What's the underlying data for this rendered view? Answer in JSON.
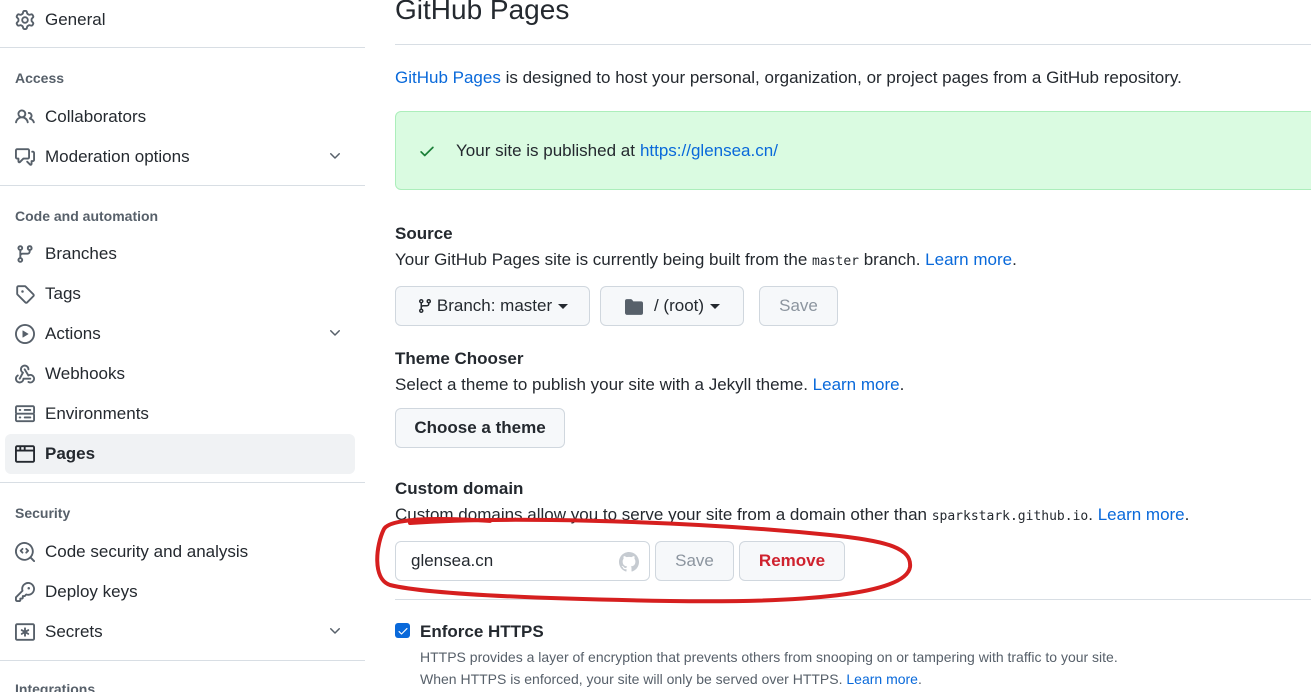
{
  "sidebar": {
    "general": "General",
    "access_head": "Access",
    "collaborators": "Collaborators",
    "moderation": "Moderation options",
    "code_head": "Code and automation",
    "branches": "Branches",
    "tags": "Tags",
    "actions": "Actions",
    "webhooks": "Webhooks",
    "environments": "Environments",
    "pages": "Pages",
    "security_head": "Security",
    "code_security": "Code security and analysis",
    "deploy_keys": "Deploy keys",
    "secrets": "Secrets",
    "integrations_head": "Integrations"
  },
  "main": {
    "title": "GitHub Pages",
    "intro_link": "GitHub Pages",
    "intro_rest": " is designed to host your personal, organization, or project pages from a GitHub repository.",
    "flash_text": "Your site is published at ",
    "flash_url": "https://glensea.cn/",
    "source": {
      "heading": "Source",
      "desc_a": "Your GitHub Pages site is currently being built from the ",
      "desc_code": "master",
      "desc_b": " branch. ",
      "learn_more": "Learn more",
      "branch_label": "Branch: master",
      "folder_label": "/ (root)",
      "save": "Save"
    },
    "theme": {
      "heading": "Theme Chooser",
      "desc": "Select a theme to publish your site with a Jekyll theme. ",
      "learn_more": "Learn more",
      "button": "Choose a theme"
    },
    "domain": {
      "heading": "Custom domain",
      "desc_a": "Custom domains allow you to serve your site from a domain other than ",
      "desc_code": "sparkstark.github.io",
      "desc_b": ". ",
      "learn_more": "Learn more",
      "value": "glensea.cn",
      "save": "Save",
      "remove": "Remove"
    },
    "https": {
      "label": "Enforce HTTPS",
      "checked": true,
      "line1": "HTTPS provides a layer of encryption that prevents others from snooping on or tampering with traffic to your site.",
      "line2": "When HTTPS is enforced, your site will only be served over HTTPS. ",
      "learn_more": "Learn more"
    }
  },
  "colors": {
    "accent": "#0969da",
    "success_bg": "#dafbe1",
    "danger": "#cf222e",
    "annotation": "#d61f1f"
  }
}
